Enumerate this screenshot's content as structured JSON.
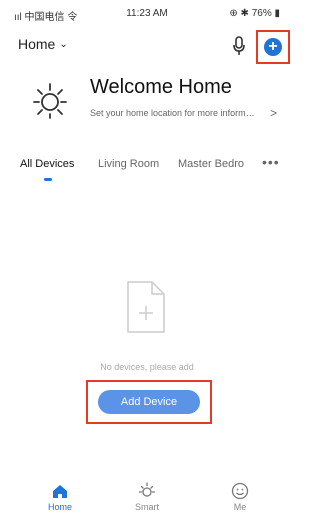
{
  "status_bar": {
    "carrier_text": "ııl 中国电信 令",
    "time": "11:23 AM",
    "right_text": "⊕ ✱ 76% ▮"
  },
  "header": {
    "home_label": "Home",
    "home_chevron": "⌄",
    "mic_icon": "microphone-icon",
    "add_icon": "plus-circle-icon"
  },
  "welcome": {
    "title": "Welcome Home",
    "subtitle": "Set your home location for more informa...",
    "chevron": ">"
  },
  "room_tabs": [
    {
      "label": "All Devices",
      "active": true
    },
    {
      "label": "Living Room",
      "active": false
    },
    {
      "label": "Master Bedro",
      "active": false
    }
  ],
  "more_label": "•••",
  "empty_state": {
    "icon": "add-file-icon",
    "text": "No devices, please add"
  },
  "add_device_button": {
    "label": "Add Device"
  },
  "bottom_tabs": [
    {
      "label": "Home",
      "icon": "home-icon",
      "active": true
    },
    {
      "label": "Smart",
      "icon": "sun-icon",
      "active": false
    },
    {
      "label": "Me",
      "icon": "smiley-icon",
      "active": false
    }
  ],
  "colors": {
    "accent": "#1f74d8",
    "button": "#5b93e6",
    "highlight": "#e53b25"
  }
}
